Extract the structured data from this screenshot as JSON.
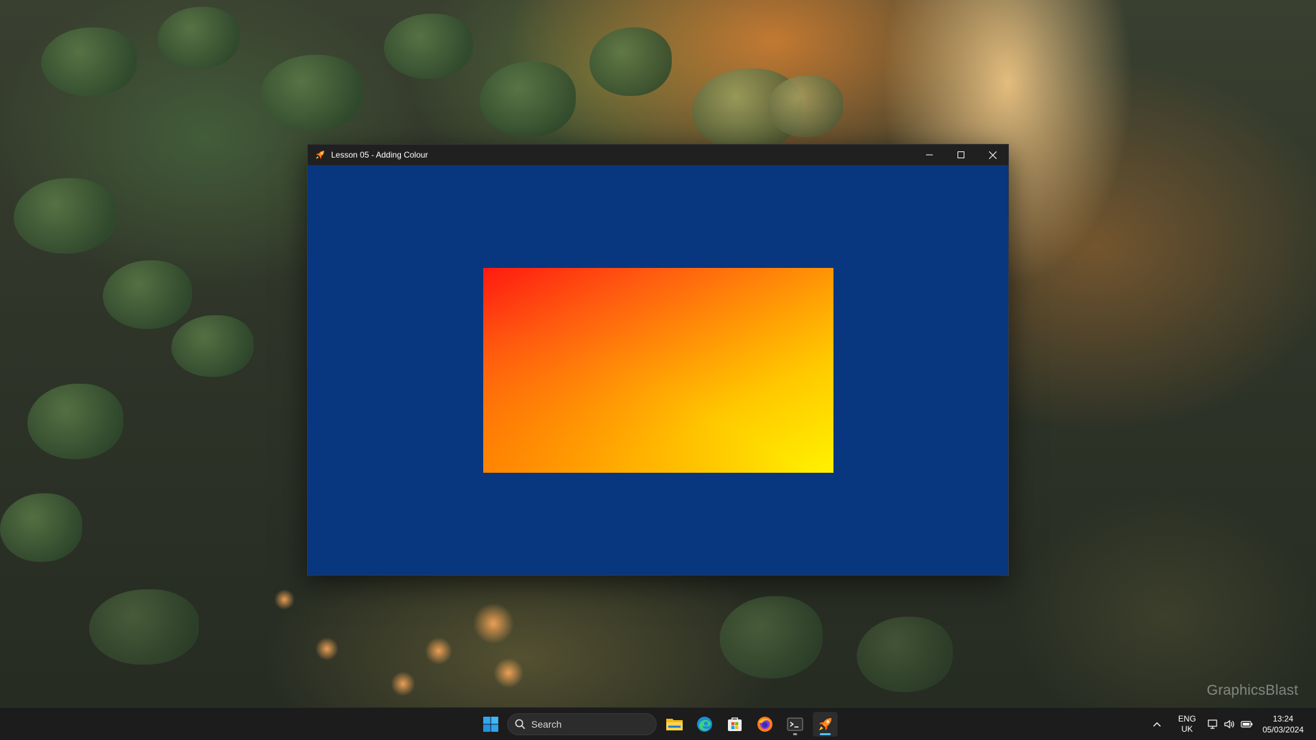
{
  "window": {
    "title": "Lesson 05 - Adding Colour",
    "client_background": "#08367f",
    "quad_colors": {
      "top_left": "#ff1a10",
      "top_right": "#fff200",
      "bottom_left": "#ff7a00",
      "bottom_right": "#ff8a00"
    },
    "controls": [
      "minimize-icon",
      "maximize-icon",
      "close-icon"
    ]
  },
  "watermark": "GraphicsBlast",
  "taskbar": {
    "search_label": "Search",
    "pinned_apps": [
      "windows-start-icon",
      "file-explorer-icon",
      "edge-icon",
      "store-icon",
      "firefox-icon",
      "terminal-icon",
      "rocket-app-icon"
    ],
    "tray": {
      "language": "ENG",
      "region": "UK",
      "time": "13:24",
      "date": "05/03/2024",
      "icons": [
        "chevron-up-icon",
        "network-icon",
        "volume-icon",
        "battery-icon"
      ]
    }
  }
}
